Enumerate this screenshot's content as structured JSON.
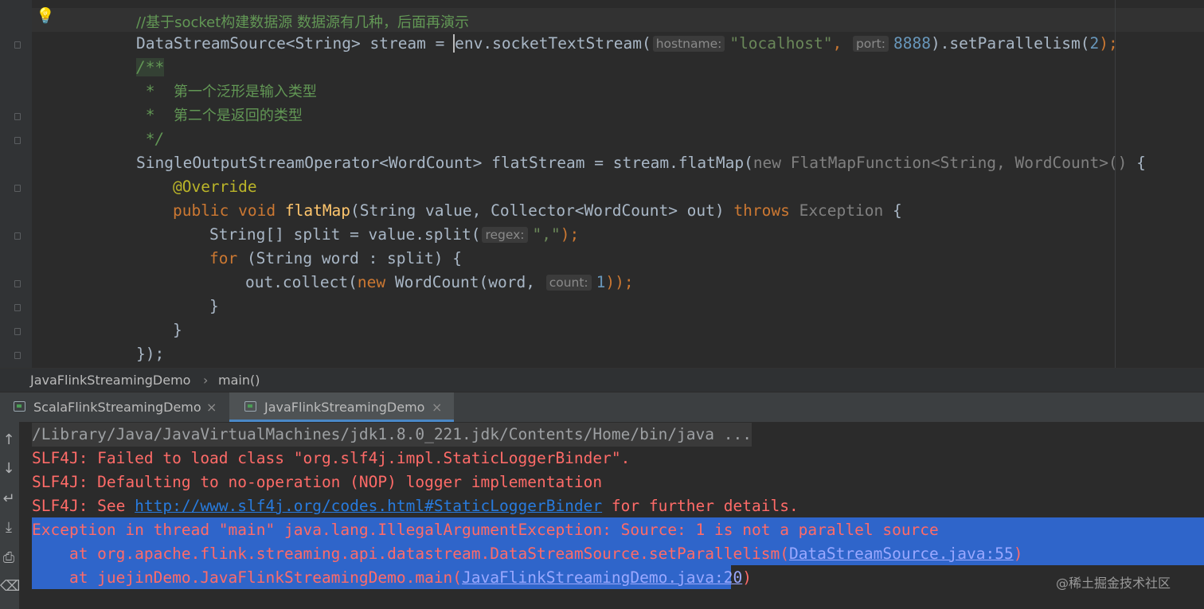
{
  "editor": {
    "line0": "//基于socket构建数据源 数据源有几种，后面再演示",
    "line1": {
      "p1": "DataStreamSource<String> stream = ",
      "p2": "env.socketTextStream(",
      "hint_hostname": "hostname:",
      "str_localhost": "\"localhost\"",
      "comma": ",",
      "hint_port": "port:",
      "num_port": "8888",
      "p3": ").setParallelism(",
      "num_par": "2",
      "p4": ");"
    },
    "line2": "/**",
    "line3_star": " *  ",
    "line3_text": "第一个泛形是输入类型",
    "line4_star": " *  ",
    "line4_text": "第二个是返回的类型",
    "line5": " */",
    "line6": {
      "p1": "SingleOutputStreamOperator<WordCount> flatStream = stream.flatMap(",
      "p2": "new FlatMapFunction<String, WordCount>()",
      "p3": " {"
    },
    "line7": "@Override",
    "line8": {
      "kw1": "public void ",
      "fn": "flatMap",
      "p1": "(String value, Collector<WordCount> out) ",
      "kw2": "throws ",
      "exc": "Exception",
      "p2": " {"
    },
    "line9": {
      "p1": "String[] split = value.split(",
      "hint_regex": "regex:",
      "str": "\",\"",
      "p2": ");"
    },
    "line10": {
      "kw": "for",
      "p1": " (String word : split) {"
    },
    "line11": {
      "p1": "out.collect(",
      "kw": "new",
      "p2": " WordCount(word,",
      "hint_count": "count:",
      "num": "1",
      "p3": "));"
    },
    "line12": "}",
    "line13": "}",
    "line14": "});",
    "line15": "/**"
  },
  "breadcrumb": {
    "class_name": "JavaFlinkStreamingDemo",
    "separator": "›",
    "method": "main()"
  },
  "tabs": [
    {
      "label": "ScalaFlinkStreamingDemo",
      "close": "×"
    },
    {
      "label": "JavaFlinkStreamingDemo",
      "close": "×"
    }
  ],
  "console": {
    "line0": "/Library/Java/JavaVirtualMachines/jdk1.8.0_221.jdk/Contents/Home/bin/java ...",
    "line1": "SLF4J: Failed to load class \"org.slf4j.impl.StaticLoggerBinder\".",
    "line2": "SLF4J: Defaulting to no-operation (NOP) logger implementation",
    "line3_pre": "SLF4J: See ",
    "line3_link": "http://www.slf4j.org/codes.html#StaticLoggerBinder",
    "line3_post": " for further details.",
    "line4": "Exception in thread \"main\" java.lang.IllegalArgumentException: Source: 1 is not a parallel source",
    "line5_pre": "    at org.apache.flink.streaming.api.datastream.DataStreamSource.setParallelism(",
    "line5_link": "DataStreamSource.java:55",
    "line5_post": ")",
    "line6_pre": "    at juejinDemo.JavaFlinkStreamingDemo.main(",
    "line6_link": "JavaFlinkStreamingDemo.java:20",
    "line6_post": ")"
  },
  "toolbar_icons": [
    "up-arrow-icon",
    "down-arrow-icon",
    "soft-wrap-icon",
    "scroll-to-end-icon",
    "print-icon",
    "trash-icon"
  ],
  "watermark": "@稀土掘金技术社区",
  "colors": {
    "editor_bg": "#2b2b2b",
    "keyword": "#cc7832",
    "string": "#6a8759",
    "number": "#6897bb",
    "comment": "#629755",
    "error_text": "#ff6b68",
    "link": "#287bde",
    "selection": "#2f65ca"
  }
}
